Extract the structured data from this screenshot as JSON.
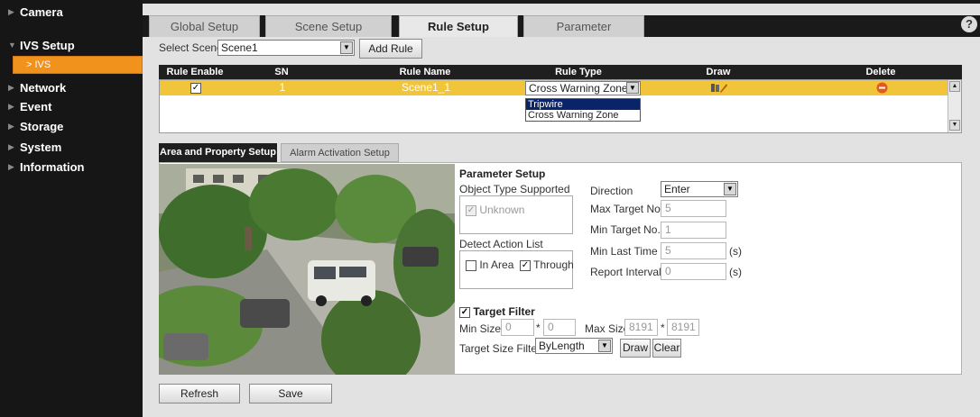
{
  "sidebar": {
    "items": [
      {
        "label": "Camera"
      },
      {
        "label": "IVS Setup"
      },
      {
        "label": "Network"
      },
      {
        "label": "Event"
      },
      {
        "label": "Storage"
      },
      {
        "label": "System"
      },
      {
        "label": "Information"
      }
    ],
    "subitem": "> IVS"
  },
  "tabs": [
    "Global Setup",
    "Scene Setup",
    "Rule Setup",
    "Parameter"
  ],
  "help_glyph": "?",
  "scene": {
    "label": "Select Scene",
    "selected": "Scene1",
    "add_rule": "Add Rule"
  },
  "table": {
    "headers": [
      "Rule Enable",
      "SN",
      "Rule Name",
      "Rule Type",
      "Draw",
      "Delete"
    ],
    "rows": [
      {
        "enabled": true,
        "sn": "1",
        "name": "Scene1_1",
        "type": "Cross Warning Zone"
      }
    ],
    "type_options": [
      "Tripwire",
      "Cross Warning Zone"
    ]
  },
  "subtabs": [
    "Area and Property Setup",
    "Alarm Activation Setup"
  ],
  "params": {
    "title": "Parameter Setup",
    "object_type_label": "Object Type Supported",
    "object_unknown": "Unknown",
    "detect_action_label": "Detect Action List",
    "in_area": "In Area",
    "through": "Through",
    "direction_label": "Direction",
    "direction_value": "Enter",
    "max_target_label": "Max Target No.",
    "max_target_value": "5",
    "min_target_label": "Min Target No.",
    "min_target_value": "1",
    "min_last_label": "Min Last Time",
    "min_last_value": "5",
    "report_label": "Report Interval",
    "report_value": "0",
    "unit_s": "(s)"
  },
  "target": {
    "label": "Target Filter",
    "min_size_label": "Min Size",
    "min_w": "0",
    "min_h": "0",
    "max_size_label": "Max Size",
    "max_w": "8191",
    "max_h": "8191",
    "times": "*",
    "size_filter_label": "Target Size Filter",
    "size_filter_value": "ByLength",
    "draw": "Draw",
    "clear": "Clear"
  },
  "footer": {
    "refresh": "Refresh",
    "save": "Save"
  }
}
